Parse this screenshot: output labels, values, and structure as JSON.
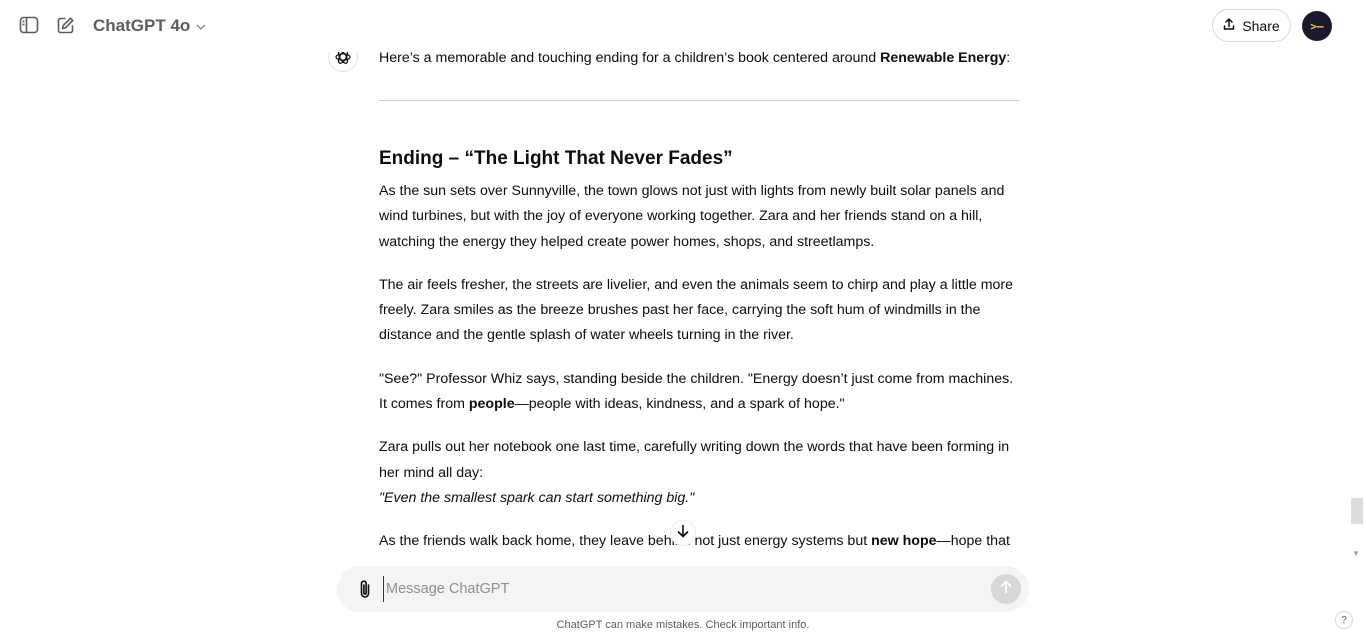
{
  "header": {
    "model_name": "ChatGPT 4o",
    "share_label": "Share",
    "avatar_text": ">–"
  },
  "message": {
    "intro_before": "Here’s a memorable and touching ending for a children’s book centered around ",
    "intro_bold": "Renewable Energy",
    "intro_after": ":",
    "heading": "Ending – “The Light That Never Fades”",
    "p1": "As the sun sets over Sunnyville, the town glows not just with lights from newly built solar panels and wind turbines, but with the joy of everyone working together. Zara and her friends stand on a hill, watching the energy they helped create power homes, shops, and streetlamps.",
    "p2": "The air feels fresher, the streets are livelier, and even the animals seem to chirp and play a little more freely. Zara smiles as the breeze brushes past her face, carrying the soft hum of windmills in the distance and the gentle splash of water wheels turning in the river.",
    "p3_before": "\"See?\" Professor Whiz says, standing beside the children. \"Energy doesn’t just come from machines. It comes from ",
    "p3_bold": "people",
    "p3_after": "—people with ideas, kindness, and a spark of hope.\"",
    "p4": "Zara pulls out her notebook one last time, carefully writing down the words that have been forming in her mind all day:",
    "p4_quote": "\"Even the smallest spark can start something big.\"",
    "p5_before": "As the friends walk back home, they leave behind not just energy systems but ",
    "p5_bold": "new hope",
    "p5_after": "—hope that"
  },
  "composer": {
    "placeholder": "Message ChatGPT"
  },
  "footer": {
    "disclaimer": "ChatGPT can make mistakes. Check important info.",
    "help_label": "?"
  },
  "colors": {
    "text": "#0d0d0d",
    "muted": "#5d5d5d",
    "composer_bg": "#f4f4f4",
    "send_disabled": "#d7d7d7"
  }
}
